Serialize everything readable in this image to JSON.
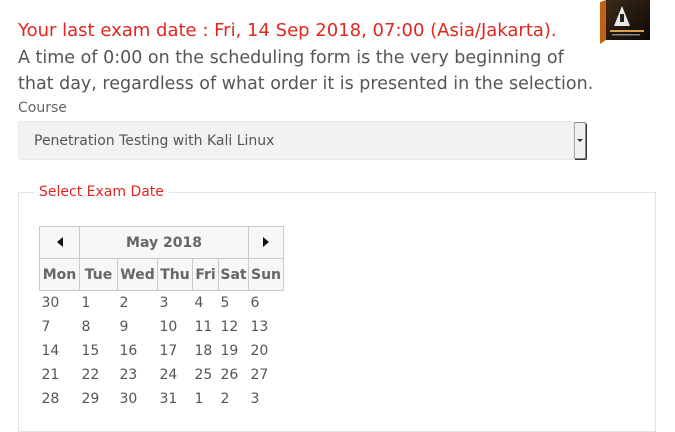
{
  "header": {
    "exam_date_text": "Your last exam date : Fri, 14 Sep 2018, 07:00 (Asia/Jakarta).",
    "info_text": "A time of 0:00 on the scheduling form is the very beginning of that day, regardless of what order it is presented in the selection."
  },
  "course": {
    "label": "Course",
    "selected": "Penetration Testing with Kali Linux"
  },
  "exam_date_section": {
    "legend": "Select Exam Date"
  },
  "calendar": {
    "month_title": "May 2018",
    "weekdays": [
      "Mon",
      "Tue",
      "Wed",
      "Thu",
      "Fri",
      "Sat",
      "Sun"
    ],
    "weeks": [
      [
        "30",
        "1",
        "2",
        "3",
        "4",
        "5",
        "6"
      ],
      [
        "7",
        "8",
        "9",
        "10",
        "11",
        "12",
        "13"
      ],
      [
        "14",
        "15",
        "16",
        "17",
        "18",
        "19",
        "20"
      ],
      [
        "21",
        "22",
        "23",
        "24",
        "25",
        "26",
        "27"
      ],
      [
        "28",
        "29",
        "30",
        "31",
        "1",
        "2",
        "3"
      ]
    ]
  },
  "colors": {
    "accent_red": "#e0271f",
    "text_gray": "#555555"
  },
  "icons": {
    "prev": "chevron-left-icon",
    "next": "chevron-right-icon",
    "dropdown": "chevron-down-icon"
  }
}
